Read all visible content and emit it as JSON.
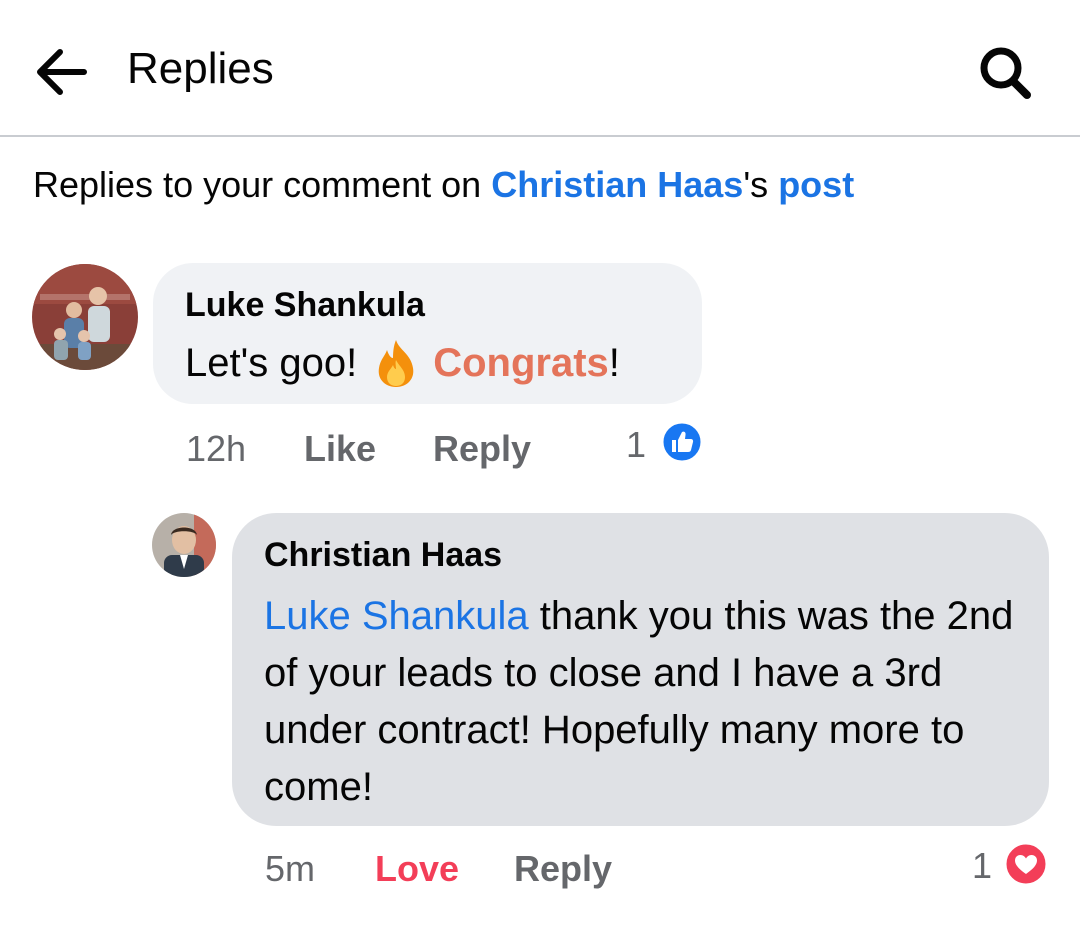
{
  "header": {
    "title": "Replies"
  },
  "context": {
    "prefix": "Replies to your comment on ",
    "author": "Christian Haas",
    "possessive": "'s ",
    "post_link": "post"
  },
  "comments": [
    {
      "author": "Luke Shankula",
      "text_before": "Let's goo!",
      "emoji": "fire-emoji",
      "highlight": "Congrats",
      "text_after": "!",
      "time": "12h",
      "like_label": "Like",
      "reply_label": "Reply",
      "reaction_count": "1",
      "reaction_type": "like",
      "reaction_color": "#1877f2"
    },
    {
      "author": "Christian Haas",
      "mention": "Luke Shankula",
      "text": " thank you this was the 2nd of your leads to close and I have a 3rd under contract! Hopefully many more to come!",
      "time": "5m",
      "love_label": "Love",
      "reply_label": "Reply",
      "reaction_count": "1",
      "reaction_type": "love",
      "reaction_color": "#f33e58"
    }
  ],
  "colors": {
    "link": "#1b74e4",
    "congrats": "#e4745a",
    "love": "#f33e58",
    "secondary_text": "#65676b"
  }
}
